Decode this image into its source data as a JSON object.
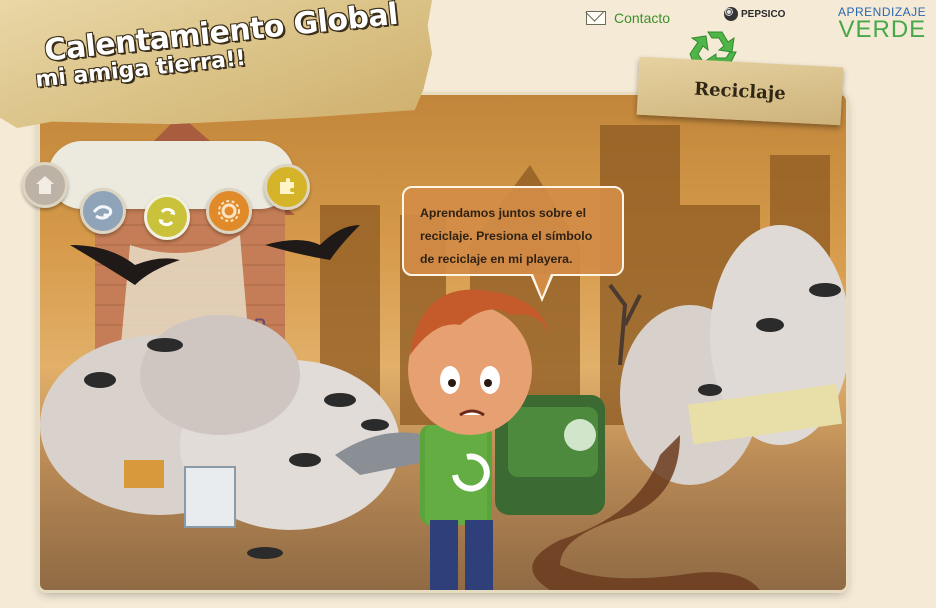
{
  "header": {
    "contact_label": "Contacto",
    "contact_icon": "envelope-icon",
    "pepsico_label": "PEPSICO",
    "aprendizaje_line1": "APRENDIZAJE",
    "aprendizaje_line2": "VERDE"
  },
  "title": {
    "line1": "Calentamiento Global",
    "line2": "mi amiga tierra!!"
  },
  "section": {
    "label": "Reciclaje",
    "icon": "recycle-icon"
  },
  "nav": {
    "items": [
      {
        "name": "home",
        "icon": "house-icon",
        "color": "#bdb2a6"
      },
      {
        "name": "wind",
        "icon": "wind-icon",
        "color": "#8fa4b8"
      },
      {
        "name": "recycle",
        "icon": "recycle-icon",
        "color": "#c9c23a",
        "active": true
      },
      {
        "name": "sun",
        "icon": "sun-icon",
        "color": "#e08a2a"
      },
      {
        "name": "pieces",
        "icon": "puzzle-icon",
        "color": "#d6b42a"
      }
    ]
  },
  "bubble": {
    "text": "Aprendamos juntos sobre el reciclaje. Presiona el símbolo de reciclaje en mi playera."
  },
  "colors": {
    "accent_green": "#3f8f2a",
    "brand_blue": "#2a67b0",
    "brand_green": "#47a84a"
  }
}
